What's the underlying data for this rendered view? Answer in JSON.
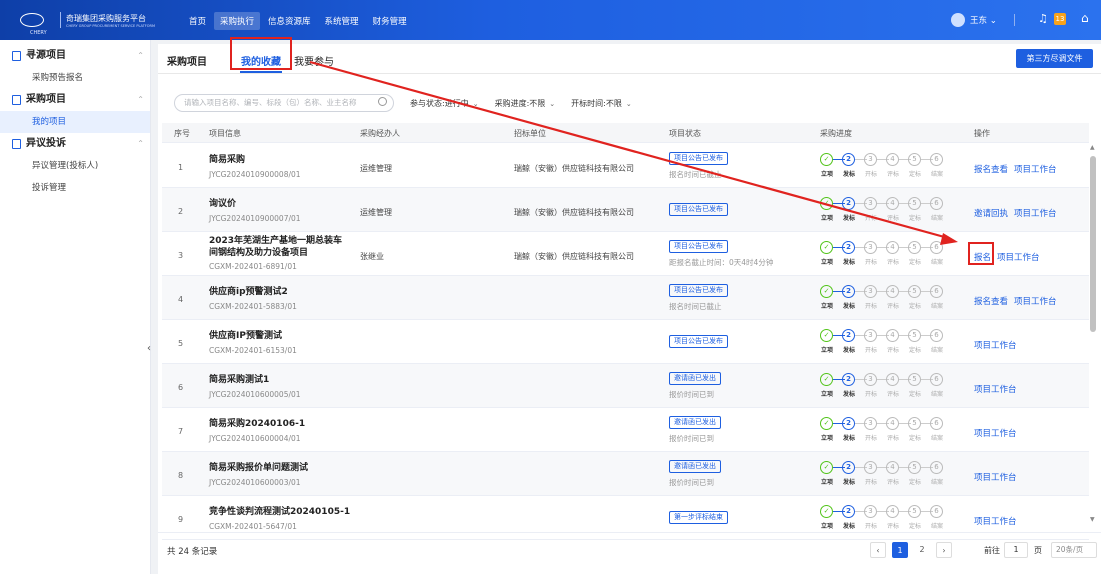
{
  "topbar": {
    "brand": "CHERY",
    "title": "奇瑞集团采购服务平台",
    "title_sub": "CHERY GROUP PROCUREMENT SERVICE PLATFORM",
    "nav": [
      "首页",
      "采购执行",
      "信息资源库",
      "系统管理",
      "财务管理"
    ],
    "user": "王东 ⌄",
    "badge": "13"
  },
  "sidebar": {
    "groups": [
      {
        "label": "寻源项目",
        "items": [
          "采购预告报名"
        ]
      },
      {
        "label": "采购项目",
        "items": [
          "我的项目"
        ]
      },
      {
        "label": "异议投诉",
        "items": [
          "异议管理(投标人)",
          "投诉管理"
        ]
      }
    ]
  },
  "tabs": {
    "t1": "采购项目",
    "t2": "我的收藏",
    "t3": "我要参与",
    "btn": "第三方尽调文件"
  },
  "filters": {
    "search_placeholder": "请输入项目名称、编号、标段（包）名称、业主名称",
    "f1": "参与状态:进行中",
    "f2": "采购进度:不限",
    "f3": "开标时间:不限"
  },
  "columns": [
    "序号",
    "项目信息",
    "采购经办人",
    "招标单位",
    "项目状态",
    "采购进度",
    "操作"
  ],
  "progress_labels": [
    "立项",
    "发标",
    "开标",
    "评标",
    "定标",
    "结案"
  ],
  "rows": [
    {
      "num": "1",
      "name": "简易采购",
      "code": "JYCG2024010900008/01",
      "agent": "运维管理",
      "org": "瑞鲸（安徽）供应链科技有限公司",
      "status": "项目公告已发布",
      "note": "报名时间已截止",
      "a1": "报名查看",
      "a2": "项目工作台"
    },
    {
      "num": "2",
      "name": "询议价",
      "code": "JYCG2024010900007/01",
      "agent": "运维管理",
      "org": "瑞鲸（安徽）供应链科技有限公司",
      "status": "项目公告已发布",
      "note": "",
      "a1": "邀请回执",
      "a2": "项目工作台"
    },
    {
      "num": "3",
      "name": "2023年芜湖生产基地一期总装车\n间钢结构及助力设备项目",
      "code": "CGXM-202401-6891/01",
      "agent": "张继业",
      "org": "瑞鲸（安徽）供应链科技有限公司",
      "status": "项目公告已发布",
      "note": "距报名截止时间：0天4时4分钟",
      "a1": "报名",
      "a2": "项目工作台"
    },
    {
      "num": "4",
      "name": "供应商ip预警测试2",
      "code": "CGXM-202401-5883/01",
      "agent": "",
      "org": "",
      "status": "项目公告已发布",
      "note": "报名时间已截止",
      "a1": "报名查看",
      "a2": "项目工作台"
    },
    {
      "num": "5",
      "name": "供应商IP预警测试",
      "code": "CGXM-202401-6153/01",
      "agent": "",
      "org": "",
      "status": "项目公告已发布",
      "note": "",
      "a1": "",
      "a2": "项目工作台"
    },
    {
      "num": "6",
      "name": "简易采购测试1",
      "code": "JYCG2024010600005/01",
      "agent": "",
      "org": "",
      "status": "邀请函已发出",
      "note": "报价时间已到",
      "a1": "",
      "a2": "项目工作台"
    },
    {
      "num": "7",
      "name": "简易采购20240106-1",
      "code": "JYCG2024010600004/01",
      "agent": "",
      "org": "",
      "status": "邀请函已发出",
      "note": "报价时间已到",
      "a1": "",
      "a2": "项目工作台"
    },
    {
      "num": "8",
      "name": "简易采购报价单问题测试",
      "code": "JYCG2024010600003/01",
      "agent": "",
      "org": "",
      "status": "邀请函已发出",
      "note": "报价时间已到",
      "a1": "",
      "a2": "项目工作台"
    },
    {
      "num": "9",
      "name": "竞争性谈判流程测试20240105-1",
      "code": "CGXM-202401-5647/01",
      "agent": "",
      "org": "",
      "status": "第一步评标结束",
      "note": "",
      "a1": "",
      "a2": "项目工作台"
    }
  ],
  "footer": {
    "total": "共 24 条记录",
    "pages": [
      "1",
      "2"
    ],
    "goto": "前往",
    "page_val": "1",
    "page_unit": "页",
    "psize": "20条/页"
  }
}
